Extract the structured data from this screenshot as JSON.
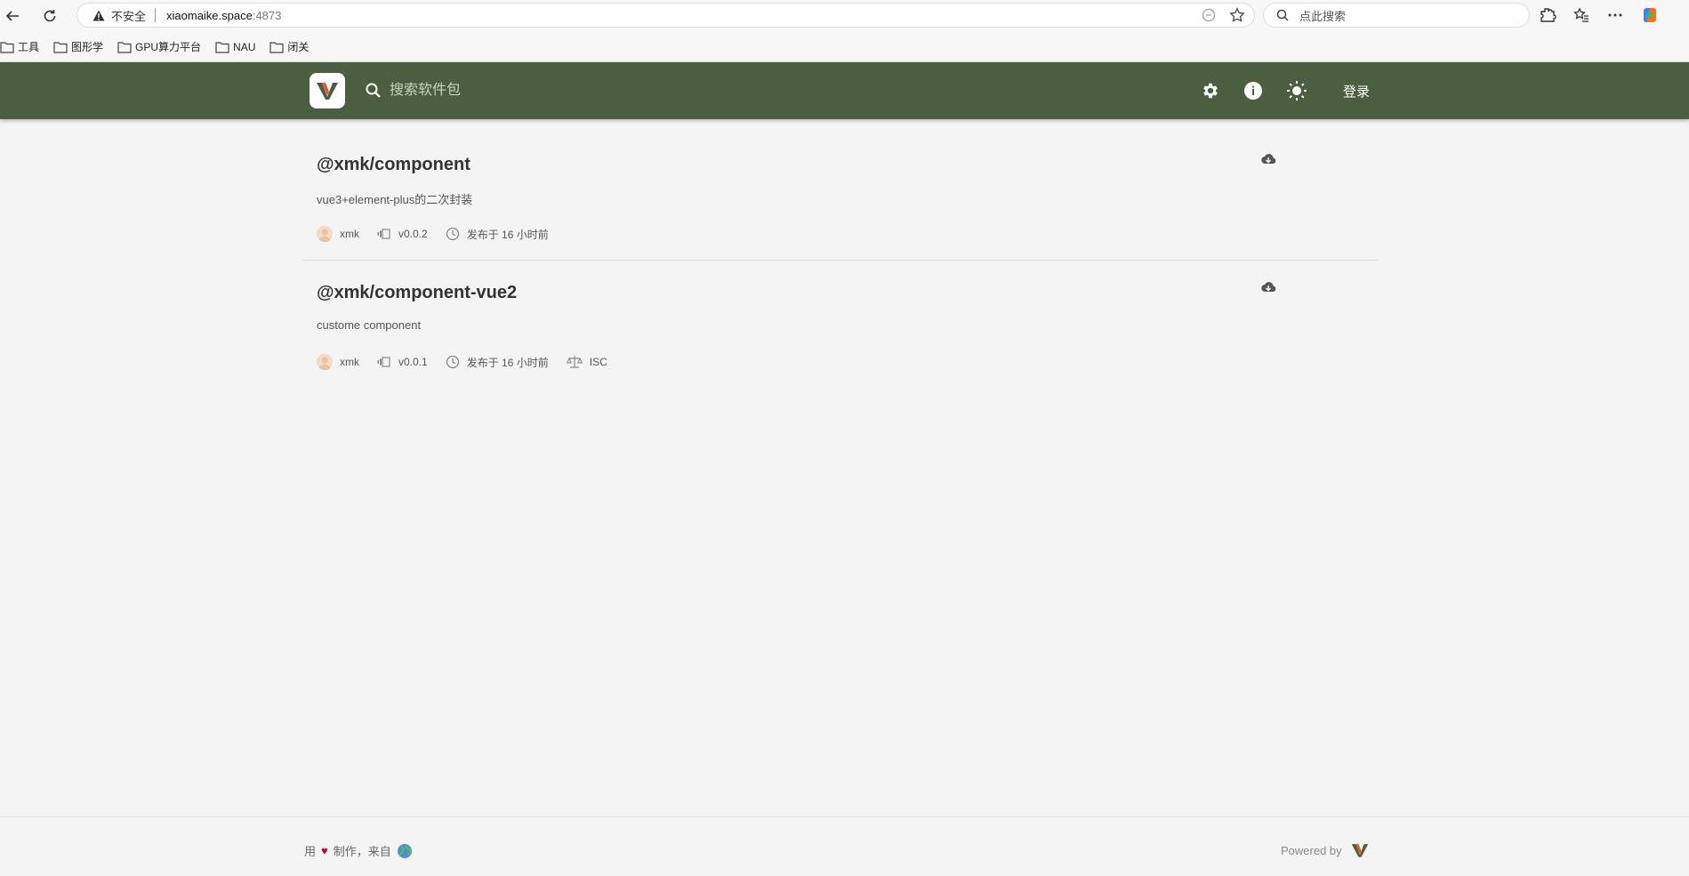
{
  "browser": {
    "insecure_label": "不安全",
    "host": "xiaomaike.space",
    "port": ":4873",
    "search_placeholder": "点此搜索",
    "bookmarks": [
      "工具",
      "图形学",
      "GPU算力平台",
      "NAU",
      "闭关"
    ]
  },
  "app": {
    "search_placeholder": "搜索软件包",
    "login_label": "登录",
    "brand_color": "#4b5e40"
  },
  "packages": [
    {
      "name": "@xmk/component",
      "description": "vue3+element-plus的二次封装",
      "author": "xmk",
      "version": "v0.0.2",
      "published": "发布于 16 小时前",
      "license": ""
    },
    {
      "name": "@xmk/component-vue2",
      "description": "custome component",
      "author": "xmk",
      "version": "v0.0.1",
      "published": "发布于 16 小时前",
      "license": "ISC"
    }
  ],
  "footer": {
    "made_with_prefix": "用",
    "made_with_suffix": "制作，来自",
    "powered_by": "Powered by"
  }
}
